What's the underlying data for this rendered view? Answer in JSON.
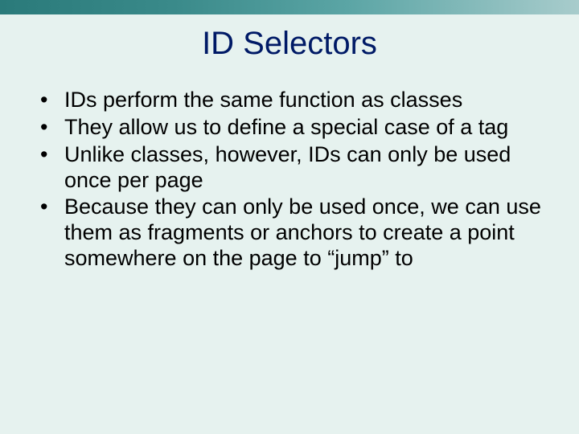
{
  "title": "ID Selectors",
  "bullets": [
    "IDs perform the same function as classes",
    "They allow us to define a special case of a tag",
    "Unlike classes, however, IDs can only be used once per page",
    "Because they can only be used once, we can use them as fragments or anchors to create a point somewhere on the page to “jump” to"
  ]
}
